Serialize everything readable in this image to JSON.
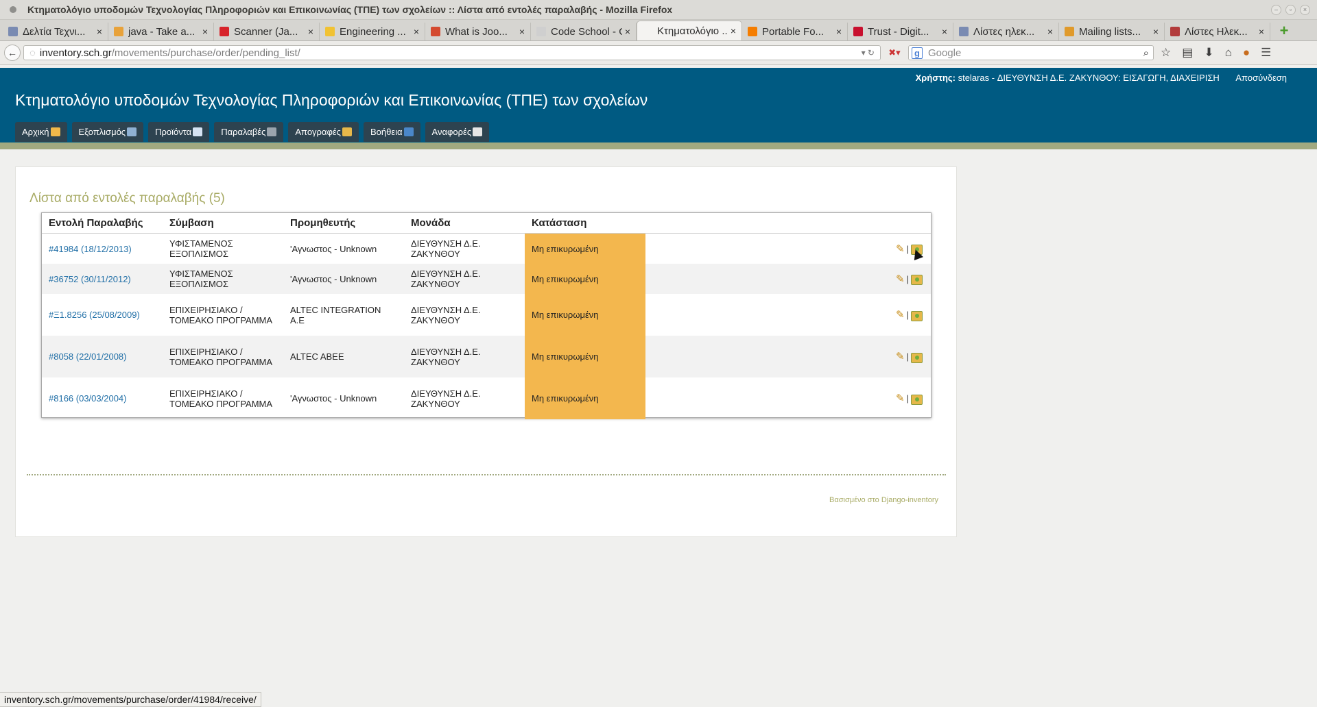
{
  "window": {
    "title": "Κτηματολόγιο υποδομών Τεχνολογίας Πληροφοριών και Επικοινωνίας (ΤΠΕ) των σχολείων :: Λίστα από εντολές παραλαβής - Mozilla Firefox"
  },
  "tabs": [
    {
      "label": "Δελτία Τεχνι...",
      "fav_color": "#7a8bb2"
    },
    {
      "label": "java - Take a...",
      "fav_color": "#e8a23a"
    },
    {
      "label": "Scanner (Ja...",
      "fav_color": "#d7232a"
    },
    {
      "label": "Engineering ...",
      "fav_color": "#f1c232"
    },
    {
      "label": "What is Joo...",
      "fav_color": "#d44a2f"
    },
    {
      "label": "Code School - G...",
      "fav_color": "#cfcfcf"
    },
    {
      "label": "Κτηματολόγιο ...",
      "fav_color": "#f4f3f1"
    },
    {
      "label": "Portable Fo...",
      "fav_color": "#f57d00"
    },
    {
      "label": "Trust - Digit...",
      "fav_color": "#c8102e"
    },
    {
      "label": "Λίστες ηλεκ...",
      "fav_color": "#7a8bb2"
    },
    {
      "label": "Mailing lists...",
      "fav_color": "#e09a2b"
    },
    {
      "label": "Λίστες Ηλεκ...",
      "fav_color": "#b23b3b"
    }
  ],
  "url": {
    "domain": "inventory.sch.gr",
    "path": "/movements/purchase/order/pending_list/"
  },
  "search": {
    "engine": "g",
    "placeholder": "Google"
  },
  "header": {
    "user_label": "Χρήστης:",
    "user_value": "stelaras - ΔΙΕΥΘΥΝΣΗ Δ.Ε. ΖΑΚΥΝΘΟΥ: ΕΙΣΑΓΩΓΗ, ΔΙΑΧΕΙΡΙΣΗ",
    "logout": "Αποσύνδεση",
    "site_title": "Κτηματολόγιο υποδομών Τεχνολογίας Πληροφοριών και Επικοινωνίας (ΤΠΕ) των σχολείων"
  },
  "menu": [
    {
      "label": "Αρχική",
      "icon": "home-icon",
      "icon_color": "#f0b84a"
    },
    {
      "label": "Εξοπλισμός",
      "icon": "monitor-icon",
      "icon_color": "#8fb1d3"
    },
    {
      "label": "Προϊόντα",
      "icon": "document-icon",
      "icon_color": "#d5e3f2"
    },
    {
      "label": "Παραλαβές",
      "icon": "truck-icon",
      "icon_color": "#9aa4ad"
    },
    {
      "label": "Απογραφές",
      "icon": "box-icon",
      "icon_color": "#e7b84a"
    },
    {
      "label": "Βοήθεια",
      "icon": "help-icon",
      "icon_color": "#4a87c9"
    },
    {
      "label": "Αναφορές",
      "icon": "report-icon",
      "icon_color": "#e6e6e6"
    }
  ],
  "list": {
    "title": "Λίστα από εντολές παραλαβής (5)",
    "columns": [
      "Εντολή Παραλαβής",
      "Σύμβαση",
      "Προμηθευτής",
      "Μονάδα",
      "Κατάσταση"
    ],
    "rows": [
      {
        "order": "#41984 (18/12/2013)",
        "contract": "ΥΦΙΣΤΑΜΕΝΟΣ ΕΞΟΠΛΙΣΜΟΣ",
        "supplier": "'Αγνωστος - Unknown",
        "unit": "ΔΙΕΥΘΥΝΣΗ Δ.Ε. ΖΑΚΥΝΘΟΥ",
        "status": "Μη επικυρωμένη"
      },
      {
        "order": "#36752 (30/11/2012)",
        "contract": "ΥΦΙΣΤΑΜΕΝΟΣ ΕΞΟΠΛΙΣΜΟΣ",
        "supplier": "'Αγνωστος - Unknown",
        "unit": "ΔΙΕΥΘΥΝΣΗ Δ.Ε. ΖΑΚΥΝΘΟΥ",
        "status": "Μη επικυρωμένη"
      },
      {
        "order": "#Ξ1.8256 (25/08/2009)",
        "contract": "ΕΠΙΧΕΙΡΗΣΙΑΚΟ / ΤΟΜΕΑΚΟ ΠΡΟΓΡΑΜΜΑ",
        "supplier": "ALTEC INTEGRATION A.E",
        "unit": "ΔΙΕΥΘΥΝΣΗ Δ.Ε. ΖΑΚΥΝΘΟΥ",
        "status": "Μη επικυρωμένη"
      },
      {
        "order": "#8058 (22/01/2008)",
        "contract": "ΕΠΙΧΕΙΡΗΣΙΑΚΟ / ΤΟΜΕΑΚΟ ΠΡΟΓΡΑΜΜΑ",
        "supplier": "ALTEC ABEE",
        "unit": "ΔΙΕΥΘΥΝΣΗ Δ.Ε. ΖΑΚΥΝΘΟΥ",
        "status": "Μη επικυρωμένη"
      },
      {
        "order": "#8166 (03/03/2004)",
        "contract": "ΕΠΙΧΕΙΡΗΣΙΑΚΟ / ΤΟΜΕΑΚΟ ΠΡΟΓΡΑΜΜΑ",
        "supplier": "'Αγνωστος - Unknown",
        "unit": "ΔΙΕΥΘΥΝΣΗ Δ.Ε. ΖΑΚΥΝΘΟΥ",
        "status": "Μη επικυρωμένη"
      }
    ],
    "separator": "|"
  },
  "footer": "Βασισμένο στο Django-inventory",
  "status_bar": "inventory.sch.gr/movements/purchase/order/41984/receive/",
  "colors": {
    "header_bg": "#005a82",
    "status_highlight": "#f3b74e",
    "accent_green": "#a1a980"
  }
}
